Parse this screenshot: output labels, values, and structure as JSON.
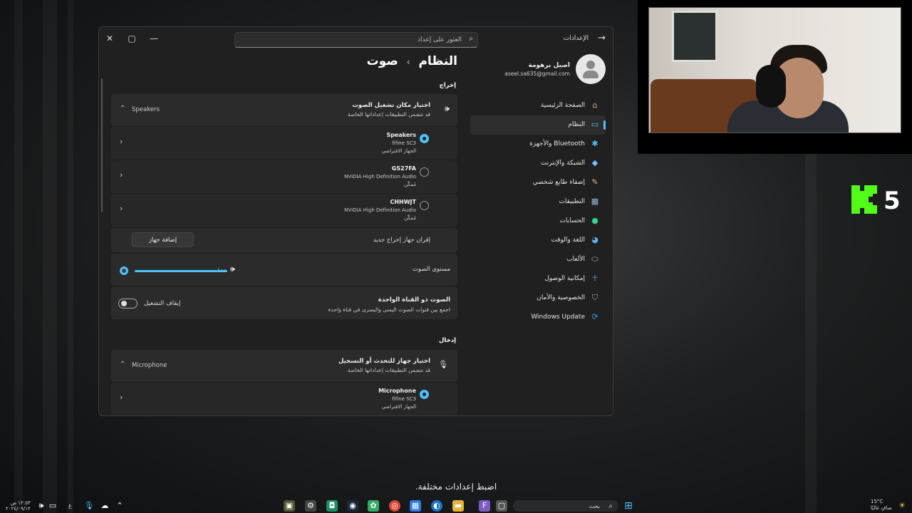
{
  "window": {
    "title": "الإعدادات",
    "search_placeholder": "العثور على إعداد",
    "close_glyph": "✕",
    "maximize_glyph": "▢",
    "minimize_glyph": "—"
  },
  "profile": {
    "name": "اصيل برهومة",
    "email": "aseel.sa635@gmail.com"
  },
  "nav": [
    {
      "label": "الصفحة الرئيسية",
      "icon": "home-icon",
      "glyph": "⌂",
      "color": "#f0a27a",
      "selected": false
    },
    {
      "label": "النظام",
      "icon": "system-icon",
      "glyph": "▭",
      "color": "#4cc2ff",
      "selected": true
    },
    {
      "label": "Bluetooth والأجهزة",
      "icon": "bluetooth-icon",
      "glyph": "✱",
      "color": "#4cc2ff",
      "selected": false
    },
    {
      "label": "الشبكة والإنترنت",
      "icon": "network-icon",
      "glyph": "◆",
      "color": "#6cc3ff",
      "selected": false
    },
    {
      "label": "إضفاء طابع شخصي",
      "icon": "brush-icon",
      "glyph": "✎",
      "color": "#f2b66d",
      "selected": false
    },
    {
      "label": "التطبيقات",
      "icon": "apps-icon",
      "glyph": "▦",
      "color": "#9bb7d8",
      "selected": false
    },
    {
      "label": "الحسابات",
      "icon": "accounts-icon",
      "glyph": "●",
      "color": "#39d08f",
      "selected": false
    },
    {
      "label": "اللغة والوقت",
      "icon": "globe-clock-icon",
      "glyph": "◕",
      "color": "#5ab4f5",
      "selected": false
    },
    {
      "label": "الألعاب",
      "icon": "gamepad-icon",
      "glyph": "⬭",
      "color": "#c0c0c8",
      "selected": false
    },
    {
      "label": "إمكانية الوصول",
      "icon": "accessibility-icon",
      "glyph": "☥",
      "color": "#4ca6f5",
      "selected": false
    },
    {
      "label": "الخصوصية والأمان",
      "icon": "shield-icon",
      "glyph": "⛉",
      "color": "#b0b0b8",
      "selected": false
    },
    {
      "label": "Windows Update",
      "icon": "update-icon",
      "glyph": "⟳",
      "color": "#2e9ff0",
      "selected": false
    }
  ],
  "breadcrumb": {
    "parent": "النظام",
    "separator": "›",
    "current": "صوت"
  },
  "output": {
    "section_label": "إخراج",
    "choose_title": "اختيار مكان تشغيل الصوت",
    "choose_sub": "قد تتضمن التطبيقات إعداداتها الخاصة",
    "selected_device": "Speakers",
    "devices": [
      {
        "name": "Speakers",
        "sub1": "fifine SC3",
        "sub2": "الجهاز الافتراضي",
        "selected": true
      },
      {
        "name": "GS27FA",
        "sub1": "NVIDIA High Definition Audio",
        "sub2": "مُمكّن",
        "selected": false
      },
      {
        "name": "CHHWJT",
        "sub1": "NVIDIA High Definition Audio",
        "sub2": "مُمكّن",
        "selected": false
      }
    ],
    "pair_label": "إقران جهاز إخراج جديد",
    "add_button": "إضافة جهاز",
    "volume_label": "مستوى الصوت",
    "volume_value": "١٠٠",
    "volume_level": 100,
    "mono_title": "الصوت ذو القناة الواحدة",
    "mono_sub": "اجمع بين قنوات الصوت اليمنى واليسرى في قناة واحدة",
    "mono_toggle_label": "إيقاف التشغيل",
    "mono_on": false
  },
  "input": {
    "section_label": "إدخال",
    "choose_title": "اختيار جهاز للتحدث أو التسجيل",
    "choose_sub": "قد تتضمن التطبيقات إعداداتها الخاصة",
    "selected_device": "Microphone",
    "devices": [
      {
        "name": "Microphone",
        "sub1": "fifine SC3",
        "sub2": "الجهاز الافتراضي",
        "selected": true
      }
    ]
  },
  "caption": "اضبط إعدادات مختلفة.",
  "overlay_logo_number": "5",
  "taskbar": {
    "search_label": "بحث",
    "weather_temp": "15°C",
    "weather_desc": "صافٍ غالبًا",
    "clock_time": "١٢:٥٣ ص",
    "clock_date": "٢٠٢٤/٠٩/١٢",
    "lang": "ع"
  },
  "colors": {
    "accent": "#4cc2ff",
    "logo_green": "#53fc18"
  }
}
